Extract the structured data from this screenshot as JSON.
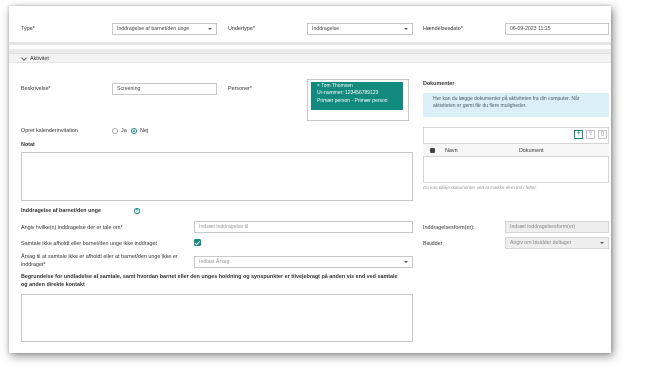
{
  "header": {
    "type_label": "Type*",
    "type_value": "Inddragelse af barnet/den unge",
    "subtype_label": "Undertype*",
    "subtype_value": "Inddragelse",
    "event_date_label": "Hændelsesdato*",
    "event_date_value": "06-09-2023 11:15"
  },
  "activity": {
    "section_title": "Aktivitet",
    "description_label": "Beskrivelse*",
    "description_value": "Screening",
    "persons_label": "Personer*",
    "person": {
      "name": "Tom Thomsen",
      "id_line": "Ur-nummer: 123456789123",
      "role": "Primær person - Primær person"
    },
    "calendar_label": "Opret kalenderinvitation",
    "calendar_options": [
      "Ja",
      "Nej"
    ],
    "calendar_selected": "Nej",
    "notes_label": "Notat"
  },
  "documents": {
    "title": "Dokumenter",
    "info": "Her kan du lægge dokumenter på aktiviteten fra din computer. Når aktiviteten er gemt får du flere muligheder.",
    "col_name": "Navn",
    "col_document": "Dokument",
    "drop_hint": "Du kan tilføje dokumenter ved at trække dem ind i feltet."
  },
  "involvement": {
    "title": "Inddragelse af barnet/den unge",
    "specify_label": "Angiv hvilke(n) inddragelse der er tale om*",
    "specify_placeholder": "Indsæt inddragelse til",
    "conversation_label": "Samtale ikke afholdt eller barnet/den unge ikke inddraget",
    "reason_label": "Årsag til at samtale ikke er afholdt eller at barnet/den unge ikke er inddraget*",
    "reason_placeholder": "Indtast Årsag",
    "justification_label": "Begrundelse for undladelse af samtale, samt hvordan barnet eller den unges holdning og synspunkter er tilvejebragt på anden vis end ved samtale og anden direkte kontakt",
    "form_label": "Inddragelsesform(er):",
    "form_placeholder": "Indsæt inddragelsesform(er)",
    "present_label": "Bisidder",
    "present_placeholder": "Angiv om bisidder deltager"
  },
  "colors": {
    "accent": "#138a7e",
    "info_bg": "#dbeff7"
  }
}
